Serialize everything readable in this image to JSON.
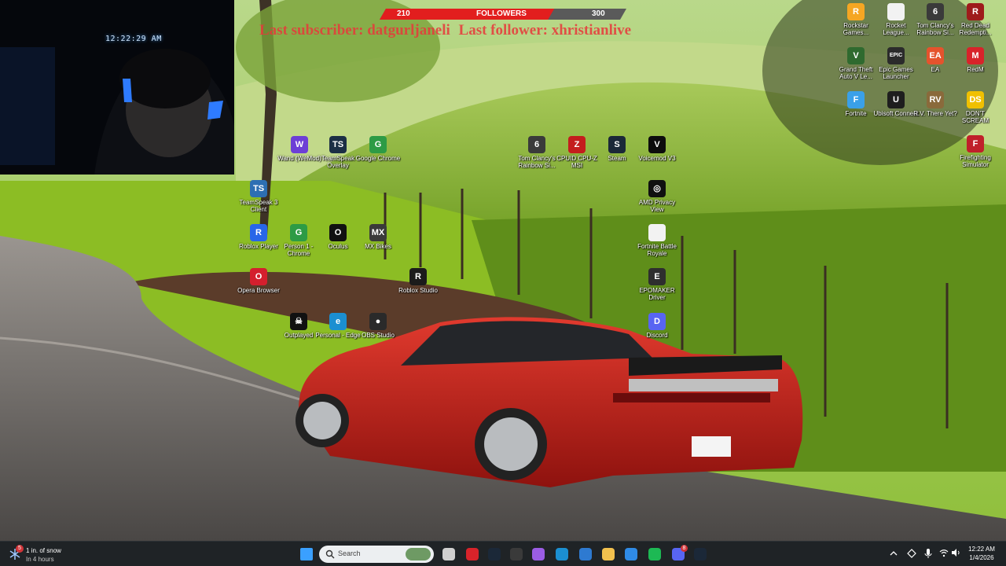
{
  "webcam": {
    "clock": "12:22:29 AM"
  },
  "followers_bar": {
    "current": "210",
    "title": "FOLLOWERS",
    "goal": "300",
    "progress_fraction": 0.7
  },
  "ticker": {
    "subscriber": "Last subscriber: datgurljaneli",
    "follower": "Last follower: xhristianlive"
  },
  "desktop_icons": [
    {
      "label": "Wand (WeMod)",
      "icon": "wand-icon",
      "color": "#6d3fd6",
      "glyph": "W"
    },
    {
      "label": "TeamSpeak Overlay",
      "icon": "teamspeak-icon",
      "color": "#1c2f45",
      "glyph": "TS"
    },
    {
      "label": "Google Chrome",
      "icon": "chrome-icon",
      "color": "#2d9b45",
      "glyph": "G"
    },
    {
      "label": "TeamSpeak 3 Client",
      "icon": "teamspeak-client-icon",
      "color": "#2d6fb3",
      "glyph": "TS"
    },
    {
      "label": "Roblox Player",
      "icon": "roblox-player-icon",
      "color": "#2866e8",
      "glyph": "R"
    },
    {
      "label": "Person 1 - Chrome",
      "icon": "chrome-person-icon",
      "color": "#2d9b45",
      "glyph": "G"
    },
    {
      "label": "Oculus",
      "icon": "oculus-icon",
      "color": "#111111",
      "glyph": "O"
    },
    {
      "label": "MX Bikes",
      "icon": "mx-bikes-icon",
      "color": "#3a3a3a",
      "glyph": "MX"
    },
    {
      "label": "Opera Browser",
      "icon": "opera-icon",
      "color": "#d41f2d",
      "glyph": "O"
    },
    {
      "label": "Roblox Studio",
      "icon": "roblox-studio-icon",
      "color": "#1b1b1b",
      "glyph": "R"
    },
    {
      "label": "Outplayed",
      "icon": "outplayed-icon",
      "color": "#111111",
      "glyph": "☠"
    },
    {
      "label": "Personal - Edge",
      "icon": "edge-icon",
      "color": "#1b8fd1",
      "glyph": "e"
    },
    {
      "label": "OBS Studio",
      "icon": "obs-icon",
      "color": "#2a2a2a",
      "glyph": "●"
    },
    {
      "label": "Tom Clancy's Rainbow Si...",
      "icon": "rainbow-six-icon",
      "color": "#3a3a3a",
      "glyph": "6"
    },
    {
      "label": "CPUID CPU-Z MSI",
      "icon": "cpuz-icon",
      "color": "#c41d1d",
      "glyph": "Z"
    },
    {
      "label": "Steam",
      "icon": "steam-icon",
      "color": "#1b2838",
      "glyph": "S"
    },
    {
      "label": "Voicemod V3",
      "icon": "voicemod-icon",
      "color": "#0d0d0d",
      "glyph": "V"
    },
    {
      "label": "AMD Privacy View",
      "icon": "amd-icon",
      "color": "#101010",
      "glyph": "◎"
    },
    {
      "label": "Fortnite Battle Royale",
      "icon": "fortnite-file-icon",
      "color": "#f2f2f2",
      "glyph": ""
    },
    {
      "label": "EPOMAKER Driver",
      "icon": "epomaker-icon",
      "color": "#2e2e2e",
      "glyph": "E"
    },
    {
      "label": "Discord",
      "icon": "discord-icon",
      "color": "#5865f2",
      "glyph": "D"
    },
    {
      "label": "Rockstar Games...",
      "icon": "rockstar-icon",
      "color": "#f5a623",
      "glyph": "R"
    },
    {
      "label": "Rocket League...",
      "icon": "rocket-league-icon",
      "color": "#f2f2f2",
      "glyph": ""
    },
    {
      "label": "Tom Clancy's Rainbow Si...",
      "icon": "rainbow-six-icon",
      "color": "#3a3a3a",
      "glyph": "6"
    },
    {
      "label": "Red Dead Redempti...",
      "icon": "red-dead-icon",
      "color": "#9e1b1b",
      "glyph": "R"
    },
    {
      "label": "Grand Theft Auto V Le...",
      "icon": "gta-icon",
      "color": "#2f6a2f",
      "glyph": "V"
    },
    {
      "label": "Epic Games Launcher",
      "icon": "epic-games-icon",
      "color": "#2b2b2b",
      "glyph": "EPIC"
    },
    {
      "label": "EA",
      "icon": "ea-icon",
      "color": "#e5532d",
      "glyph": "EA"
    },
    {
      "label": "RedM",
      "icon": "redm-icon",
      "color": "#d8232a",
      "glyph": "M"
    },
    {
      "label": "Fortnite",
      "icon": "fortnite-icon",
      "color": "#3aa0e8",
      "glyph": "F"
    },
    {
      "label": "Ubisoft Connect",
      "icon": "ubisoft-icon",
      "color": "#1e1e1e",
      "glyph": "U"
    },
    {
      "label": "R.V. There Yet?",
      "icon": "rv-there-yet-icon",
      "color": "#8a6a3b",
      "glyph": "RV"
    },
    {
      "label": "DON'T SCREAM",
      "icon": "dont-scream-icon",
      "color": "#f0c000",
      "glyph": "DS"
    },
    {
      "label": "Firefighting Simulator",
      "icon": "firefighting-icon",
      "color": "#c0202a",
      "glyph": "F"
    }
  ],
  "taskbar": {
    "weather_badge": "5",
    "weather_line1": "1 in. of snow",
    "weather_line2": "In 4 hours",
    "search_placeholder": "Search",
    "pinned": [
      {
        "name": "start-icon",
        "color": "#3aa0ff"
      },
      {
        "name": "task-view-icon",
        "color": "#cfcfcf"
      },
      {
        "name": "app-red-icon",
        "color": "#d8232a"
      },
      {
        "name": "steam-icon",
        "color": "#1b2838"
      },
      {
        "name": "obs-icon",
        "color": "#3a3a3a"
      },
      {
        "name": "copilot-icon",
        "color": "#9b5de5"
      },
      {
        "name": "edge-icon",
        "color": "#1b8fd1"
      },
      {
        "name": "mail-icon",
        "color": "#2e7ad1"
      },
      {
        "name": "file-explorer-icon",
        "color": "#f2c14e"
      },
      {
        "name": "store-icon",
        "color": "#2f8be6"
      },
      {
        "name": "spotify-icon",
        "color": "#1db954"
      },
      {
        "name": "discord-icon",
        "color": "#5865f2"
      },
      {
        "name": "steam-2-icon",
        "color": "#1b2838"
      }
    ],
    "discord_badge": "8",
    "clock_time": "12:22 AM",
    "clock_date": "1/4/2026"
  }
}
